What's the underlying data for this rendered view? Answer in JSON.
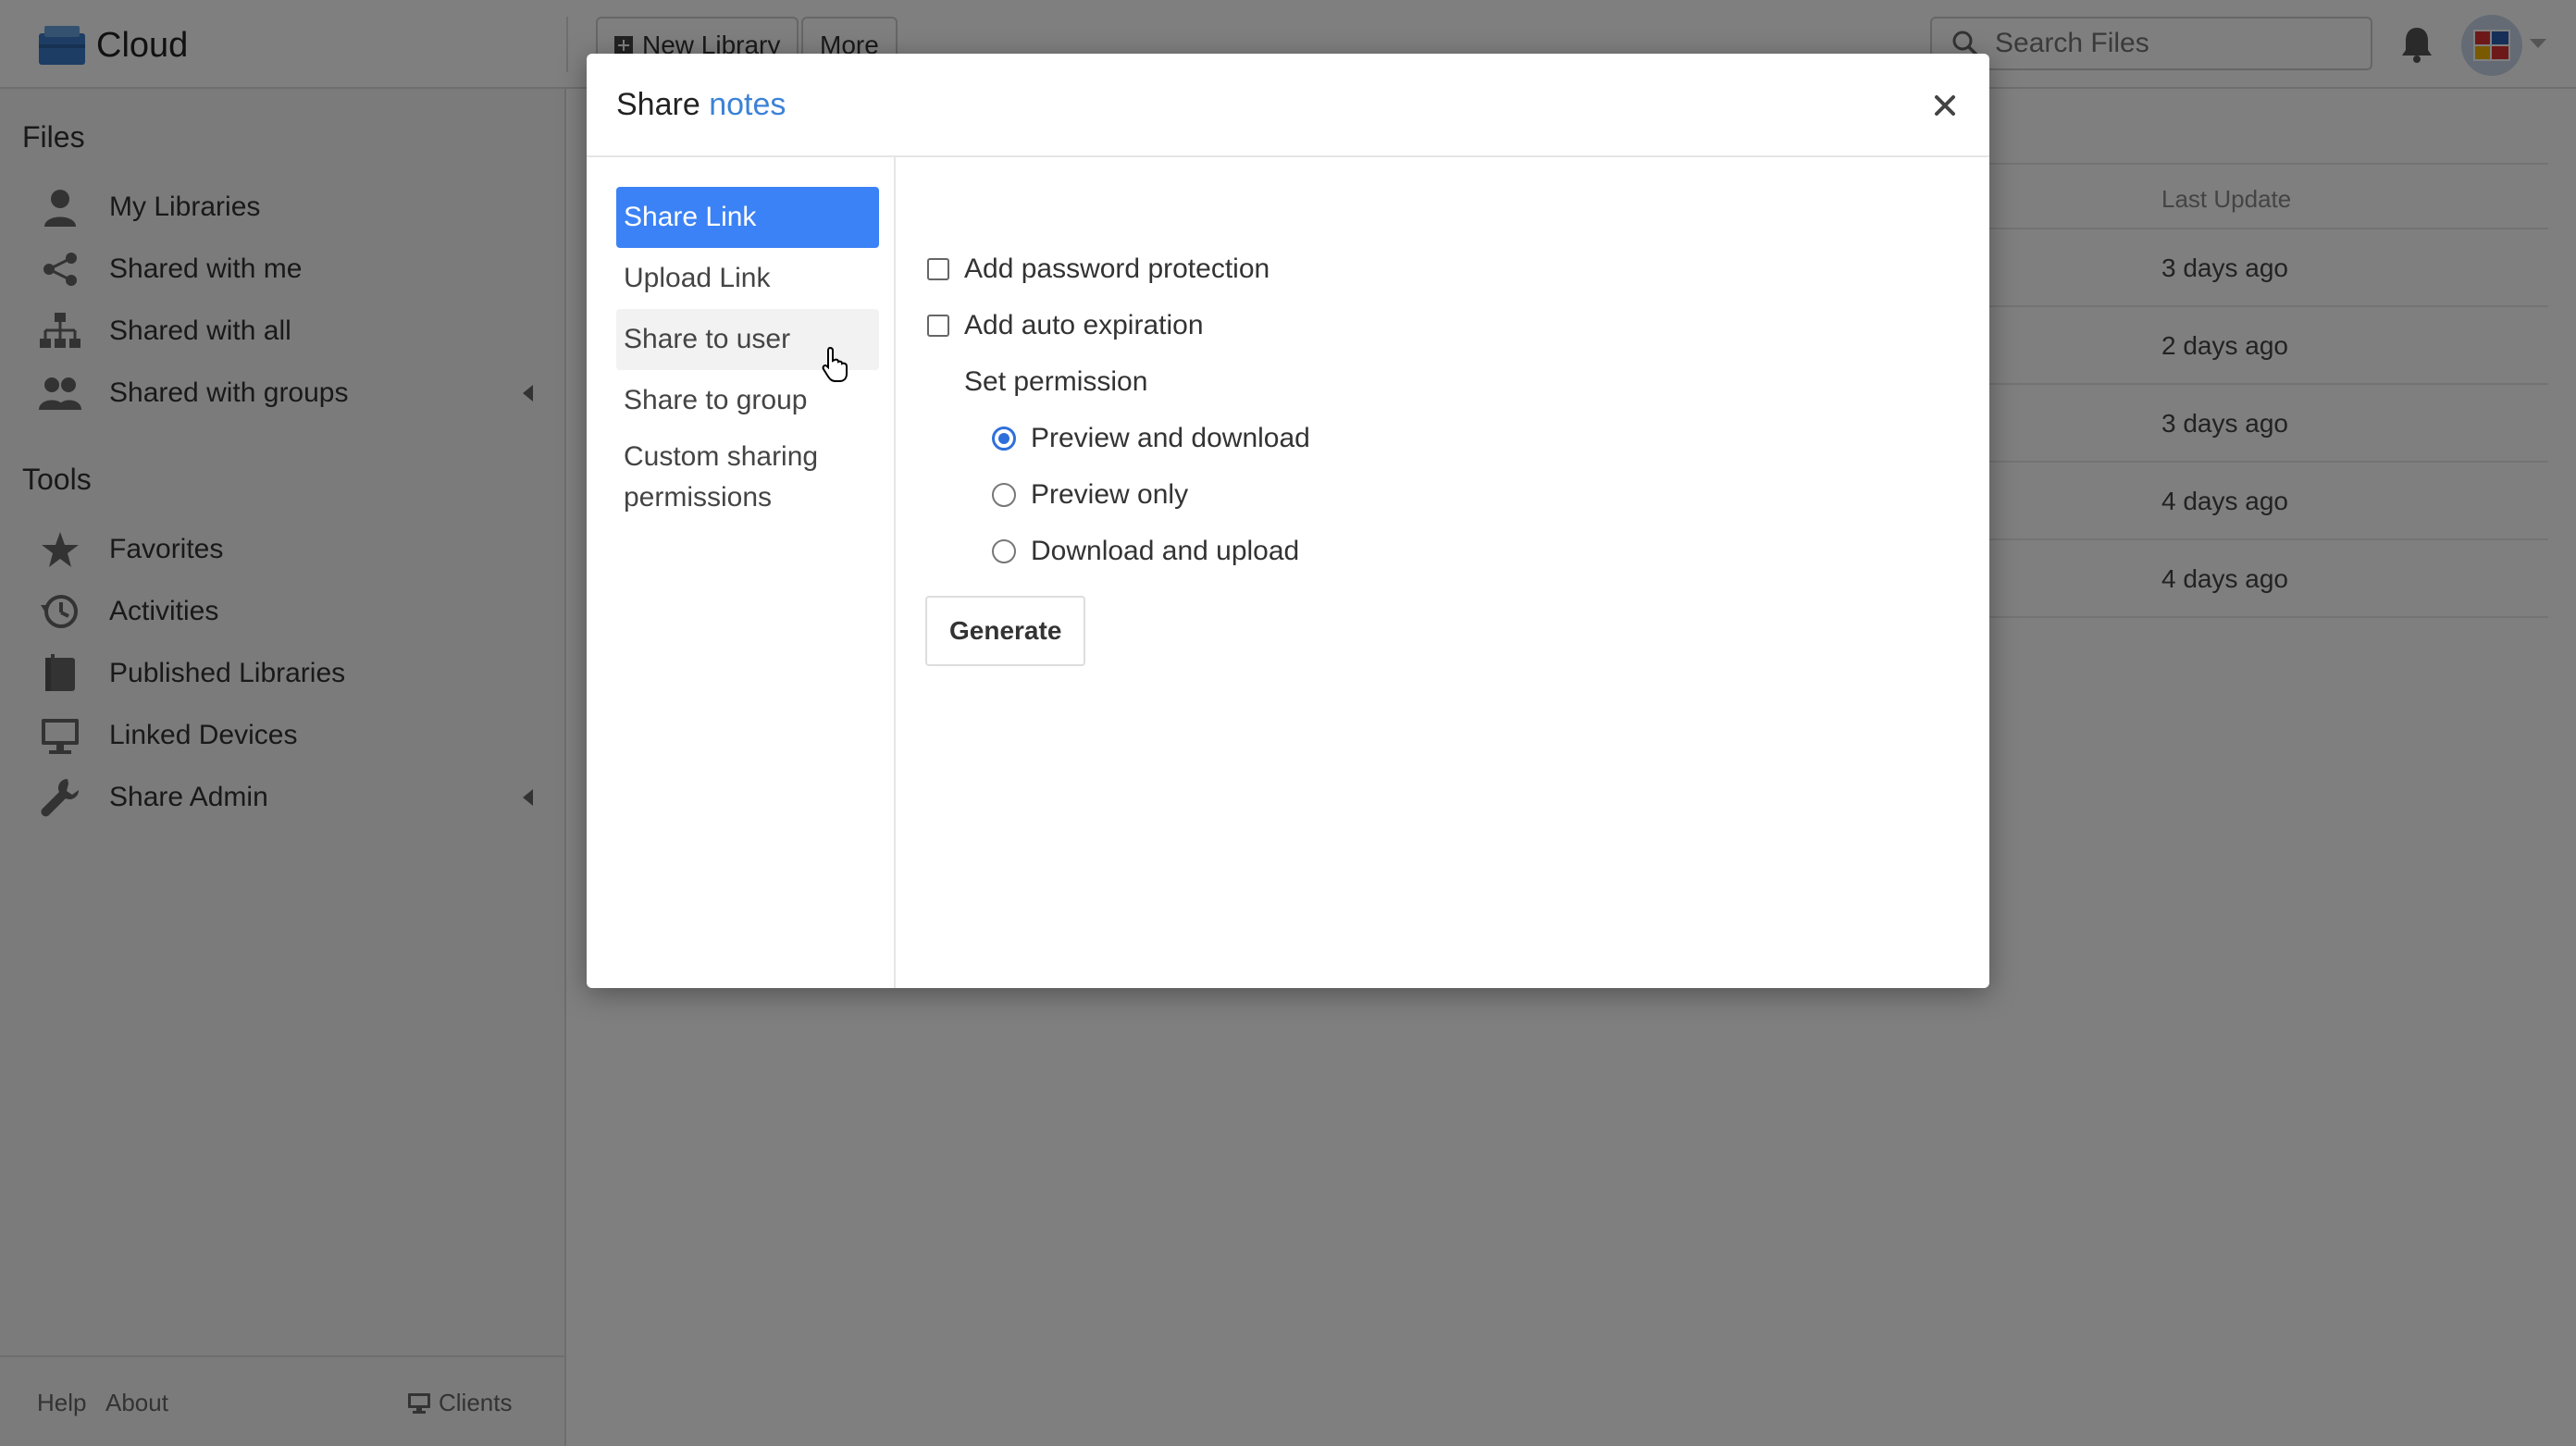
{
  "app": {
    "name": "Cloud",
    "toolbar": {
      "new_library": "New Library",
      "more": "More"
    },
    "search": {
      "placeholder": "Search Files"
    }
  },
  "sidebar": {
    "files_heading": "Files",
    "files_items": [
      {
        "label": "My Libraries",
        "icon": "user-icon"
      },
      {
        "label": "Shared with me",
        "icon": "share-icon"
      },
      {
        "label": "Shared with all",
        "icon": "org-chart-icon"
      },
      {
        "label": "Shared with groups",
        "icon": "group-icon"
      }
    ],
    "tools_heading": "Tools",
    "tools_items": [
      {
        "label": "Favorites",
        "icon": "star-icon"
      },
      {
        "label": "Activities",
        "icon": "history-icon"
      },
      {
        "label": "Published Libraries",
        "icon": "book-icon"
      },
      {
        "label": "Linked Devices",
        "icon": "monitor-icon"
      },
      {
        "label": "Share Admin",
        "icon": "wrench-icon"
      }
    ],
    "footer": {
      "help": "Help",
      "about": "About",
      "clients": "Clients"
    }
  },
  "table": {
    "last_update_header": "Last Update",
    "rows": [
      "3 days ago",
      "2 days ago",
      "3 days ago",
      "4 days ago",
      "4 days ago"
    ]
  },
  "modal": {
    "title_prefix": "Share",
    "file_name": "notes",
    "tabs": [
      "Share Link",
      "Upload Link",
      "Share to user",
      "Share to group",
      "Custom sharing permissions"
    ],
    "active_tab": "Share Link",
    "options": {
      "password": "Add password protection",
      "expiration": "Add auto expiration",
      "permission_label": "Set permission",
      "permissions": [
        "Preview and download",
        "Preview only",
        "Download and upload"
      ],
      "selected_permission": "Preview and download"
    },
    "generate_label": "Generate"
  },
  "colors": {
    "accent": "#3b82f6",
    "link": "#3b82d6"
  }
}
